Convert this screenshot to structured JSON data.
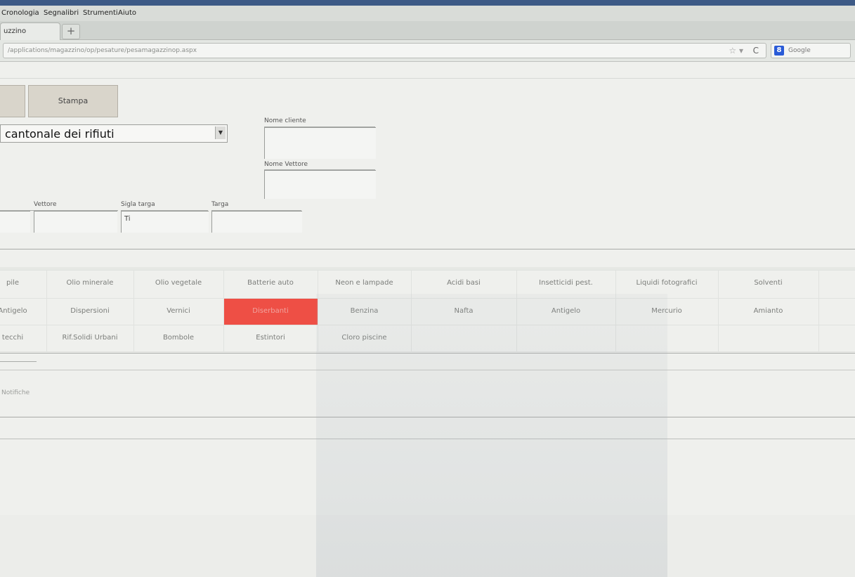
{
  "browser": {
    "menu": [
      "Cronologia",
      "Segnalibri",
      "Strumenti",
      "Aiuto"
    ],
    "tab_title": "uzzino",
    "newtab_symbol": "+",
    "url": "/applications/magazzino/op/pesature/pesamagazzinop.aspx",
    "search_provider": "Google",
    "search_icon_letter": "8"
  },
  "toolbar": {
    "stampa_label": "Stampa"
  },
  "form": {
    "site_select_value": "cantonale dei rifiuti",
    "nome_cliente_label": "Nome cliente",
    "nome_vettore_label": "Nome Vettore",
    "vettore_label": "Vettore",
    "sigla_targa_label": "Sigla targa",
    "sigla_targa_value": "Ti",
    "targa_label": "Targa"
  },
  "waste_types": {
    "rows": [
      [
        "pile",
        "Olio minerale",
        "Olio vegetale",
        "Batterie auto",
        "Neon e lampade",
        "Acidi basi",
        "Insetticidi pest.",
        "Liquidi fotografici",
        "Solventi"
      ],
      [
        "Antigelo",
        "Dispersioni",
        "Vernici",
        "Diserbanti",
        "Benzina",
        "Nafta",
        "Antigelo",
        "Mercurio",
        "Amianto"
      ],
      [
        "tecchi",
        "Rif.Solidi Urbani",
        "Bombole",
        "Estintori",
        "Cloro piscine",
        "",
        "",
        "",
        ""
      ]
    ],
    "selected": "Diserbanti",
    "selected_color": "#ee4f45"
  },
  "footer": {
    "section_label": "Notifiche"
  }
}
